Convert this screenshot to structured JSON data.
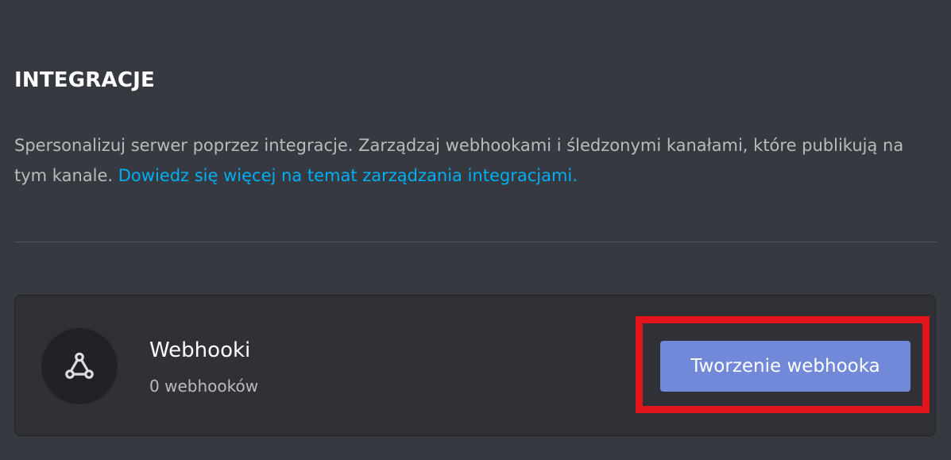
{
  "header": {
    "title": "INTEGRACJE",
    "description": "Spersonalizuj serwer poprzez integracje. Zarządzaj webhookami i śledzonymi kanałami, które publikują na tym kanale.",
    "learn_more_link": "Dowiedz się więcej na temat zarządzania integracjami."
  },
  "webhooks_card": {
    "icon": "webhook-icon",
    "title": "Webhooki",
    "count_text": "0 webhooków",
    "create_button_label": "Tworzenie webhooka"
  },
  "colors": {
    "background": "#36393f",
    "card_background": "#2f3136",
    "link": "#00aff4",
    "button": "#7289da",
    "highlight_border": "#e3141b"
  }
}
